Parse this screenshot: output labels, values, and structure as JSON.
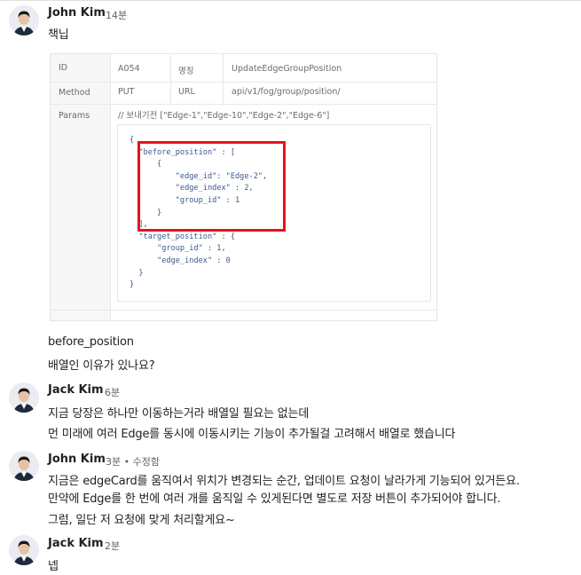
{
  "messages": [
    {
      "author": "John Kim",
      "time": "14분",
      "lines": [
        "책닙"
      ]
    },
    {
      "author": "John Kim",
      "time": "",
      "lines": [
        "before_position",
        "배열인 이유가 있나요?"
      ]
    },
    {
      "author": "Jack Kim",
      "time": "6분",
      "lines": [
        "지금 당장은 하나만 이동하는거라 배열일 필요는 없는데",
        "먼 미래에 여러 Edge를 동시에 이동시키는 기능이 추가될걸 고려해서 배열로 했습니다"
      ]
    },
    {
      "author": "John Kim",
      "time": "3분 • 수정함",
      "lines": [
        "지금은 edgeCard를 움직여서 위치가 변경되는 순간, 업데이트 요청이 날라가게 기능되어 있거든요.",
        "만약에 Edge를 한 번에 여러 개를 움직일 수 있게된다면 별도로 저장 버튼이 추가되어야 합니다.",
        "그럼, 일단 저 요청에 맞게 처리할게요~"
      ]
    },
    {
      "author": "Jack Kim",
      "time": "2분",
      "lines": [
        "넵"
      ]
    }
  ],
  "api_table": {
    "id_label": "ID",
    "id_value": "A054",
    "name_label": "명칭",
    "name_value": "UpdateEdgeGroupPosition",
    "method_label": "Method",
    "method_value": "PUT",
    "url_label": "URL",
    "url_value": "api/v1/fog/group/position/",
    "params_label": "Params",
    "params_comment": "// 보내기전 [\"Edge-1\",\"Edge-10\",\"Edge-2\",\"Edge-6\"]",
    "code_lines": [
      "{",
      "  \"before_position\" : [",
      "      {",
      "          \"edge_id\": \"Edge-2\",",
      "          \"edge_index\" : 2,",
      "          \"group_id\" : 1",
      "      }",
      "  ],",
      "  \"target_position\" : {",
      "      \"group_id\" : 1,",
      "      \"edge_index\" : 0",
      "  }",
      "}"
    ],
    "highlight_color": "#e3141a"
  },
  "avatar_icon": "user-avatar-icon"
}
